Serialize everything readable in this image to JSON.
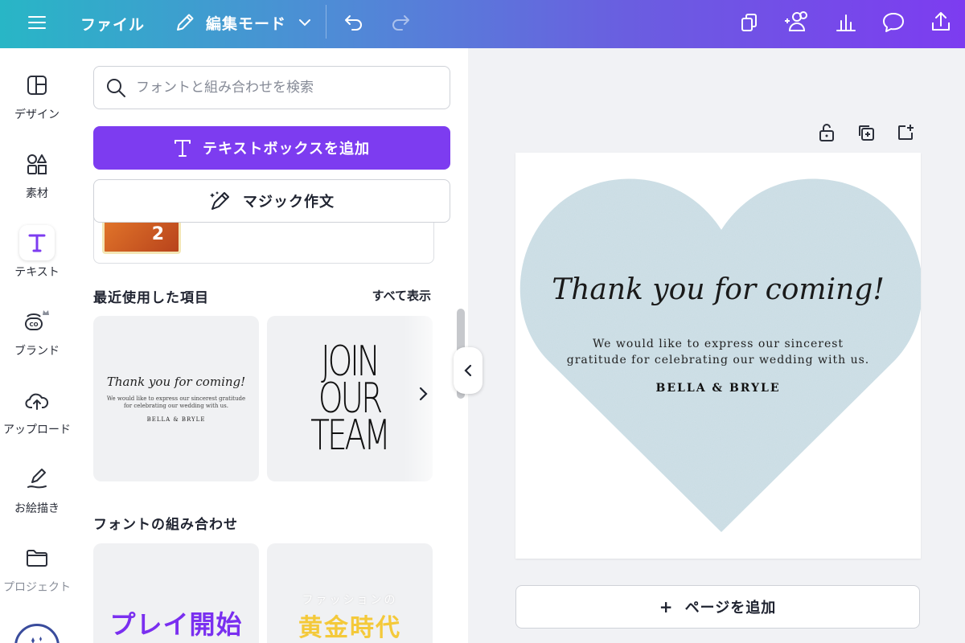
{
  "topbar": {
    "file_label": "ファイル",
    "edit_mode_label": "編集モード"
  },
  "rail": {
    "items": [
      {
        "label": "デザイン",
        "icon": "layout-icon"
      },
      {
        "label": "素材",
        "icon": "elements-icon"
      },
      {
        "label": "テキスト",
        "icon": "text-icon",
        "active": true
      },
      {
        "label": "ブランド",
        "icon": "brand-icon"
      },
      {
        "label": "アップロード",
        "icon": "upload-icon"
      },
      {
        "label": "お絵描き",
        "icon": "draw-icon"
      },
      {
        "label": "プロジェクト",
        "icon": "folder-icon"
      }
    ]
  },
  "panel": {
    "search_placeholder": "フォントと組み合わせを検索",
    "add_textbox_label": "テキストボックスを追加",
    "magic_write_label": "マジック作文",
    "partial_thumb_number": "2",
    "recent_title": "最近使用した項目",
    "see_all_label": "すべて表示",
    "recent_cards": {
      "thanks": {
        "title": "Thank you for coming!",
        "body": "We would like to express our sincerest gratitude for celebrating our wedding with us.",
        "names": "BELLA & BRYLE"
      },
      "join": {
        "line1": "JOIN",
        "line2": "OUR",
        "line3": "TEAM"
      }
    },
    "combos_title": "フォントの組み合わせ",
    "combo_cards": {
      "combo1": "プレイ開始",
      "combo2_sub": "ファッションの",
      "combo2_main": "黄金時代"
    }
  },
  "canvas": {
    "title": "Thank you for coming!",
    "body_line1": "We would like to express our sincerest",
    "body_line2": "gratitude for celebrating our wedding with us.",
    "names": "BELLA & BRYLE",
    "heart_color": "#c9dce3",
    "add_page_label": "ページを追加"
  },
  "colors": {
    "accent": "#7d3cf0",
    "gradient_start": "#28b6c6",
    "gradient_end": "#7d3cf0"
  }
}
